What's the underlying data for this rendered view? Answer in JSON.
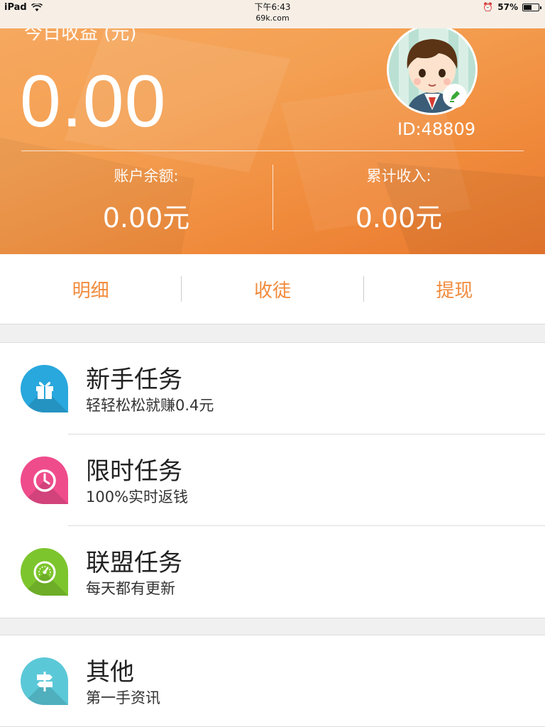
{
  "status_bar": {
    "device": "iPad",
    "time": "下午6:43",
    "url": "69k.com",
    "battery": "57%",
    "battery_level": 0.57
  },
  "header": {
    "today_label": "今日收益 (元)",
    "today_amount": "0.00",
    "user_id": "ID:48809",
    "balance_label": "账户余额:",
    "balance_value": "0.00元",
    "total_label": "累计收入:",
    "total_value": "0.00元"
  },
  "actions": {
    "details": "明细",
    "recruit": "收徒",
    "withdraw": "提现"
  },
  "tasks": [
    {
      "title": "新手任务",
      "subtitle": "轻轻松松就赚0.4元",
      "icon": "gift-icon",
      "color": "#29a8dd"
    },
    {
      "title": "限时任务",
      "subtitle": "100%实时返钱",
      "icon": "clock-icon",
      "color": "#ef4c8c"
    },
    {
      "title": "联盟任务",
      "subtitle": "每天都有更新",
      "icon": "gauge-icon",
      "color": "#7dc52d"
    }
  ],
  "other": {
    "title": "其他",
    "subtitle": "第一手资讯",
    "icon": "signpost-icon",
    "color": "#5bc8d8"
  },
  "accent_color": "#f18a3b"
}
